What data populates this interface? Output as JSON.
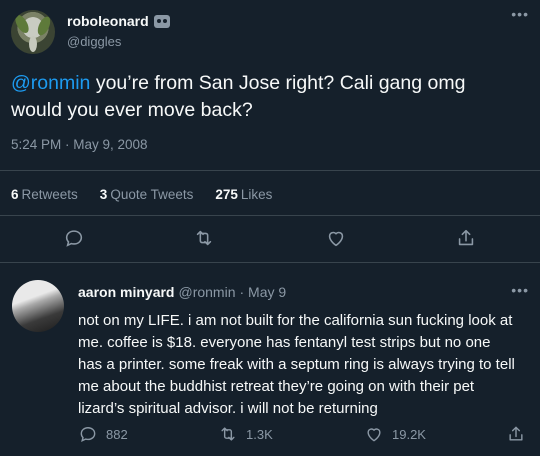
{
  "tweet": {
    "display_name": "roboleonard",
    "handle": "@diggles",
    "mention": "@ronmin",
    "text": " you’re from San Jose right? Cali gang omg would you ever move back?",
    "timestamp": "5:24 PM · May 9, 2008",
    "stats": {
      "retweets_count": "6",
      "retweets_label": "Retweets",
      "quotes_count": "3",
      "quotes_label": "Quote Tweets",
      "likes_count": "275",
      "likes_label": "Likes"
    },
    "icons": [
      "reply-icon",
      "retweet-icon",
      "like-icon",
      "share-icon"
    ]
  },
  "reply": {
    "display_name": "aaron minyard",
    "handle": "@ronmin",
    "date": "· May 9",
    "text": "not on my LIFE. i am not built for the california sun fucking look at me. coffee is $18. everyone has fentanyl test strips but no one has a printer. some freak with a septum ring is always trying to tell me about the buddhist retreat they’re going on with their pet lizard’s spiritual advisor. i will not be returning",
    "replies": "882",
    "retweets": "1.3K",
    "likes": "19.2K"
  },
  "more_label": "•••",
  "colors": {
    "background": "#15202b",
    "text": "#f7f9f9",
    "secondary": "#8b98a5",
    "accent": "#1d9bf0",
    "divider": "#38444d"
  }
}
